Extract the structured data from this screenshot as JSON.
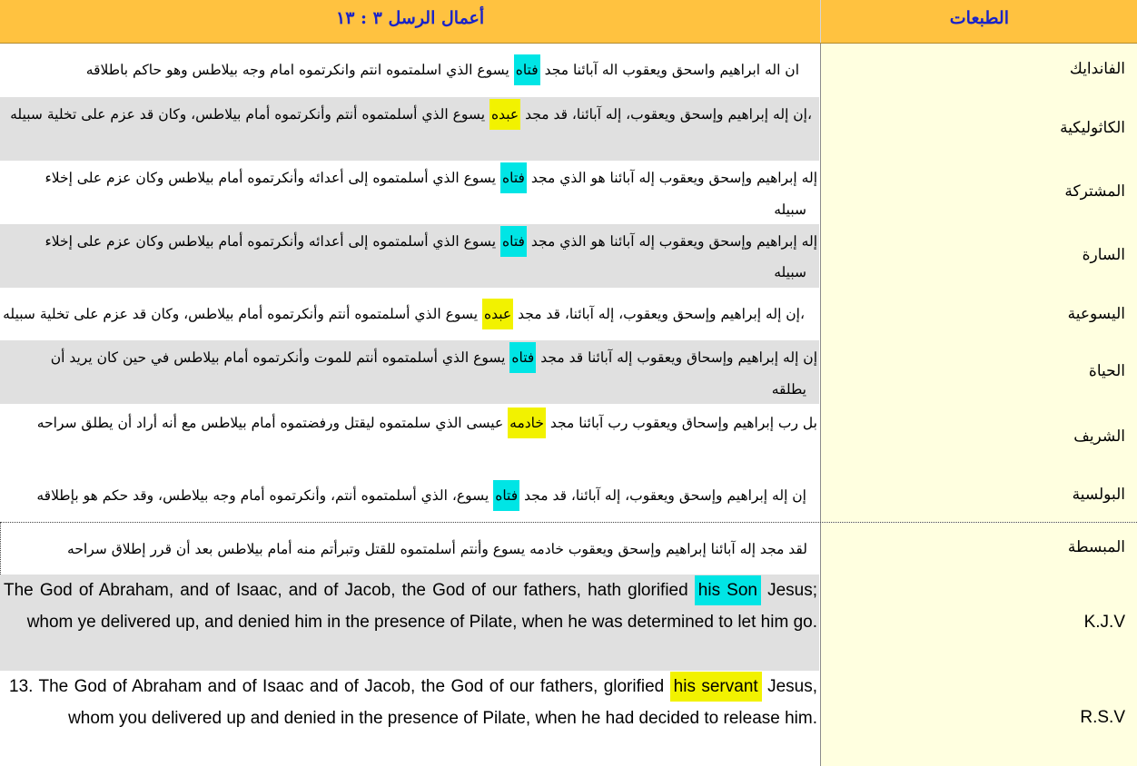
{
  "header": {
    "versions_label": "الطبعات",
    "reference": "أعمال الرسل ٣ : ١٣"
  },
  "rows": [
    {
      "name": "الفاندايك",
      "lines": [
        {
          "before": "ان اله ابراهيم واسحق ويعقوب اله آبائنا مجد ",
          "hl": "فتاه",
          "after": " يسوع الذي اسلمتموه انتم وانكرتموه امام وجه بيلاطس وهو حاكم باطلاقه"
        }
      ]
    },
    {
      "name": "الكاثوليكية",
      "lines": [
        {
          "before": "،إن إله إبراهيم وإسحق ويعقوب، إله آبائنا، قد مجد ",
          "hl": "عبده",
          "after": " يسوع الذي أسلمتموه أنتم وأنكرتموه أمام بيلاطس، وكان قد عزم على تخلية سبيله"
        }
      ]
    },
    {
      "name": "المشتركة",
      "lines": [
        {
          "before": "إله إبراهيم وإسحق ويعقوب  إله آبائنا  هو الذي مجد ",
          "hl": "فتاه",
          "after": " يسوع الذي أسلمتموه إلى أعدائه وأنكرتموه أمام بيلاطس  وكان عزم على إخلاء"
        },
        {
          "before": "سبيله",
          "hl": "",
          "after": ""
        }
      ]
    },
    {
      "name": "السارة",
      "lines": [
        {
          "before": "إله إبراهيم وإسحق ويعقوب  إله آبائنا  هو الذي مجد ",
          "hl": "فتاه",
          "after": " يسوع الذي أسلمتموه إلى أعدائه وأنكرتموه أمام بيلاطس  وكان عزم على إخلاء"
        },
        {
          "before": "سبيله",
          "hl": "",
          "after": ""
        }
      ]
    },
    {
      "name": "اليسوعية",
      "lines": [
        {
          "before": "،إن إله إبراهيم وإسحق ويعقوب، إله آبائنا، قد مجد ",
          "hl": "عبده",
          "after": " يسوع الذي أسلمتموه أنتم وأنكرتموه أمام بيلاطس، وكان قد عزم على تخلية سبيله"
        }
      ]
    },
    {
      "name": "الحياة",
      "lines": [
        {
          "before": "إن إله إبراهيم وإسحاق ويعقوب  إله آبائنا  قد مجد ",
          "hl": "فتاه",
          "after": " يسوع  الذي أسلمتموه أنتم للموت وأنكرتموه أمام بيلاطس  في حين كان يريد أن"
        },
        {
          "before": "يطلقه",
          "hl": "",
          "after": ""
        }
      ]
    },
    {
      "name": "الشريف",
      "lines": [
        {
          "before": "بل رب إبراهيم وإسحاق ويعقوب  رب آبائنا مجد ",
          "hl": "خادمه",
          "after": " عيسى  الذي سلمتموه ليقتل ورفضتموه أمام بيلاطس  مع أنه أراد أن يطلق سراحه"
        }
      ]
    },
    {
      "name": "البولسية",
      "lines": [
        {
          "before": "إن إله إبراهيم وإسحق ويعقوب، إله آبائنا، قد مجد ",
          "hl": "فتاه",
          "after": " يسوع، الذي أسلمتموه أنتم، وأنكرتموه أمام وجه بيلاطس، وقد حكم هو بإطلاقه"
        }
      ]
    },
    {
      "name": "المبسطة",
      "lines": [
        {
          "before": "لقد مجد إله آبائنا إبراهيم وإسحق ويعقوب  خادمه يسوع  وأنتم أسلمتموه للقتل  وتبرأتم منه أمام بيلاطس بعد أن قرر إطلاق سراحه",
          "hl": "",
          "after": ""
        }
      ]
    },
    {
      "name": "K.J.V",
      "before": "The God of Abraham, and of Isaac, and of Jacob, the God of our fathers, hath glorified ",
      "hl": "his Son",
      "after": " Jesus; whom ye delivered up, and denied him in the presence of Pilate, when he was determined to let him go."
    },
    {
      "name": "R.S.V",
      "before": "13. The God of Abraham and of Isaac and of Jacob, the God of our fathers, glorified ",
      "hl": "his servant",
      "after": " Jesus, whom you delivered up and denied in the presence of Pilate, when he had decided to release him."
    }
  ],
  "colors": {
    "header_bg": "#ffc240",
    "header_text": "#1a24c8",
    "name_col_bg": "#ffffe0",
    "band_grey": "#e0e0e0",
    "highlight_cyan": "#00e5e5",
    "highlight_yellow": "#f2f200"
  }
}
